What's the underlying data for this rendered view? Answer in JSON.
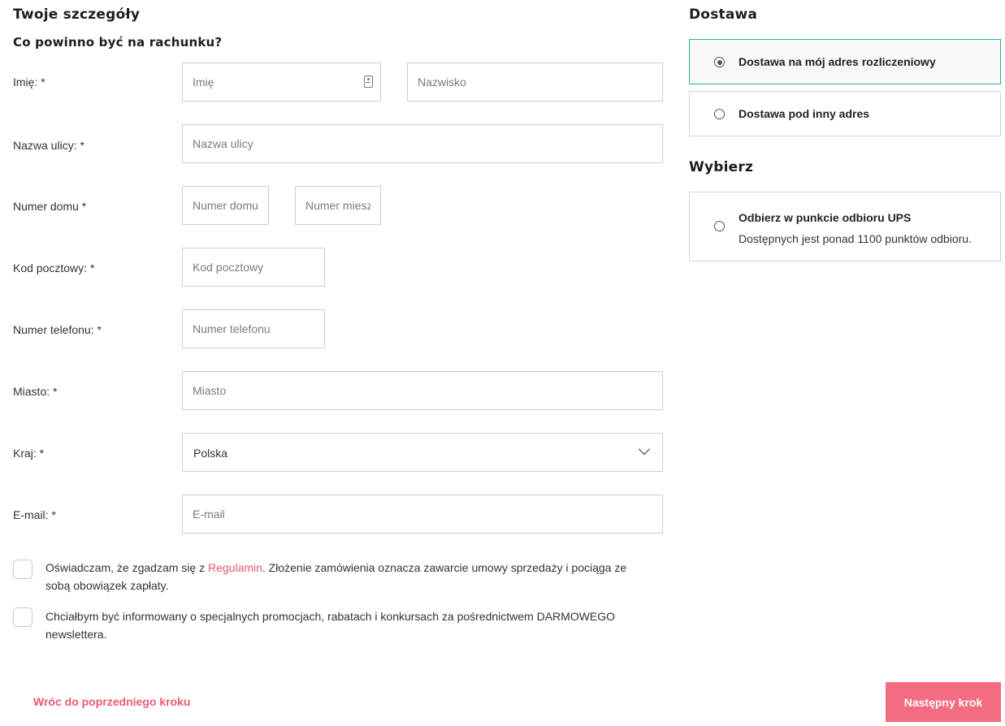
{
  "form": {
    "title": "Twoje szczegóły",
    "subtitle": "Co powinno być na rachunku?",
    "labels": {
      "first_name": "Imię: *",
      "street": "Nazwa ulicy: *",
      "house_number": "Numer domu *",
      "postal_code": "Kod pocztowy: *",
      "phone": "Numer telefonu: *",
      "city": "Miasto: *",
      "country": "Kraj: *",
      "email": "E-mail: *"
    },
    "placeholders": {
      "first_name": "Imię",
      "last_name": "Nazwisko",
      "street": "Nazwa ulicy",
      "house_number": "Numer domu",
      "apartment_number": "Numer mieszkania",
      "postal_code": "Kod pocztowy",
      "phone": "Numer telefonu",
      "city": "Miasto",
      "email": "E-mail"
    },
    "country_value": "Polska",
    "consents": {
      "terms_before": "Oświadczam, że zgadzam się z ",
      "terms_link": "Regulamin",
      "terms_after": ". Złożenie zamówienia oznacza zawarcie umowy sprzedaży i pociąga ze sobą obowiązek zapłaty.",
      "newsletter": "Chciałbym być informowany o specjalnych promocjach, rabatach i konkursach za pośrednictwem DARMOWEGO newslettera."
    }
  },
  "footer": {
    "back_label": "Wróc do poprzedniego kroku",
    "next_label": "Następny krok"
  },
  "delivery": {
    "title": "Dostawa",
    "options": [
      {
        "label": "Dostawa na mój adres rozliczeniowy",
        "selected": true
      },
      {
        "label": "Dostawa pod inny adres",
        "selected": false
      }
    ]
  },
  "pickup": {
    "title": "Wybierz",
    "option_title": "Odbierz w punkcie odbioru UPS",
    "option_subtitle": "Dostępnych jest ponad 1100 punktów odbioru."
  },
  "colors": {
    "accent": "#f36c7f",
    "link": "#e8566e",
    "selected_border": "#2bb289"
  }
}
